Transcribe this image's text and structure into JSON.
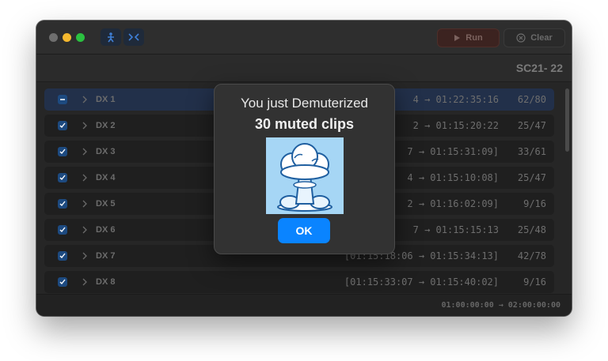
{
  "toolbar": {
    "run_label": "Run",
    "clear_label": "Clear"
  },
  "header": {
    "title": "SC21- 22"
  },
  "rows": [
    {
      "name": "DX 1",
      "tc": "4 → 01:22:35:16",
      "count": "62/80",
      "selected": true
    },
    {
      "name": "DX 2",
      "tc": "2 → 01:15:20:22",
      "count": "25/47"
    },
    {
      "name": "DX 3",
      "tc": "7 → 01:15:31:09]",
      "count": "33/61"
    },
    {
      "name": "DX 4",
      "tc": "4 → 01:15:10:08]",
      "count": "25/47"
    },
    {
      "name": "DX 5",
      "tc": "2 → 01:16:02:09]",
      "count": "9/16"
    },
    {
      "name": "DX 6",
      "tc": "7 → 01:15:15:13",
      "count": "25/48"
    },
    {
      "name": "DX 7",
      "tc": "[01:15:18:06 → 01:15:34:13]",
      "count": "42/78"
    },
    {
      "name": "DX 8",
      "tc": "[01:15:33:07 → 01:15:40:02]",
      "count": "9/16"
    }
  ],
  "footer": {
    "range": "01:00:00:00  →  02:00:00:00"
  },
  "dialog": {
    "line1": "You just Demuterized",
    "line2": "30 muted clips",
    "ok_label": "OK"
  },
  "colors": {
    "accent": "#0a84ff",
    "checkbox": "#1d4a80"
  },
  "icons": {
    "toolbar_left": "waveform-person-icon",
    "toolbar_right": "collapse-arrows-icon",
    "run": "play-icon",
    "clear": "clear-circle-icon",
    "art": "mushroom-cloud-icon"
  }
}
